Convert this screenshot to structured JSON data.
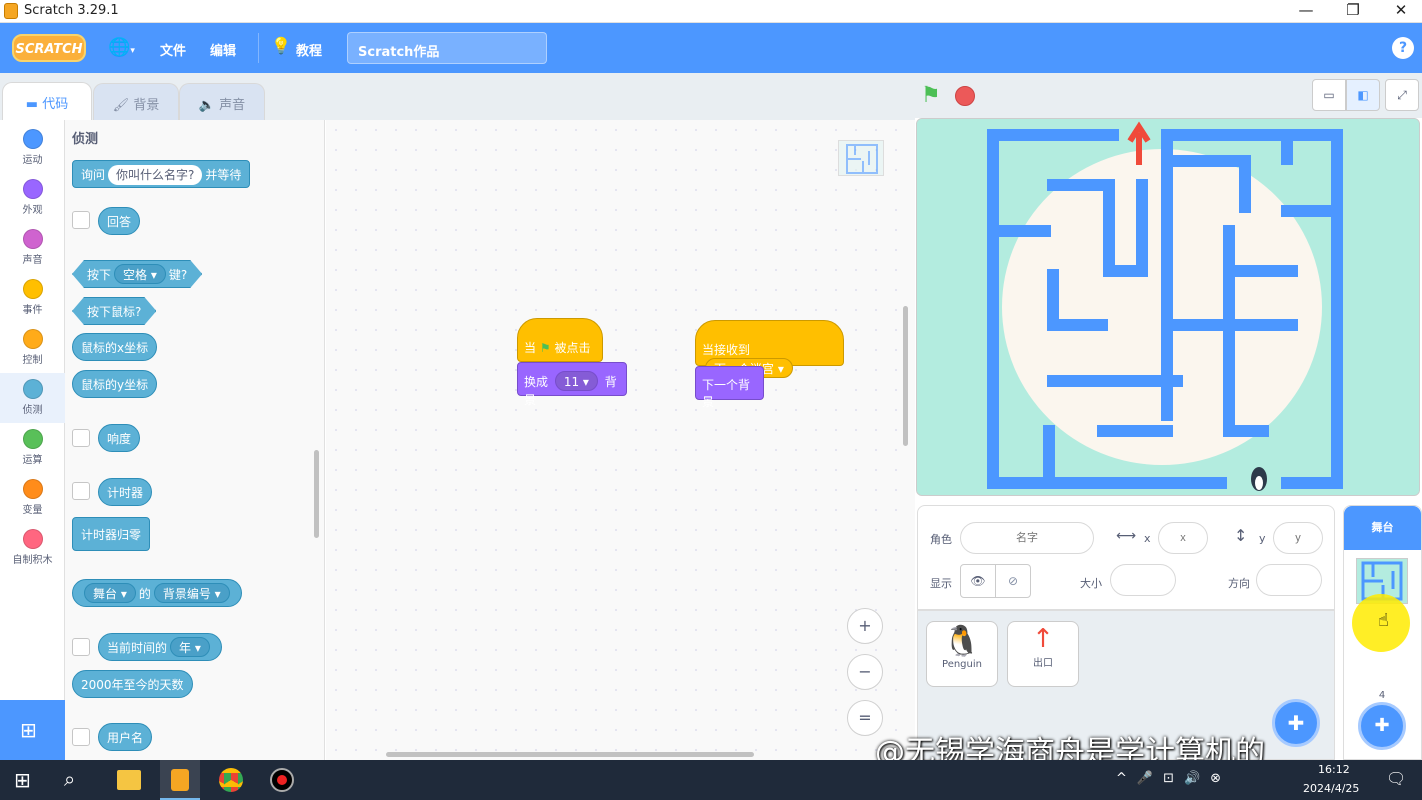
{
  "window": {
    "title": "Scratch 3.29.1",
    "min": "—",
    "restore": "❐",
    "close": "✕"
  },
  "menubar": {
    "logo": "SCRATCH",
    "file": "文件",
    "edit": "编辑",
    "tutorials": "教程",
    "project_title": "Scratch作品",
    "help": "?"
  },
  "tabs": [
    {
      "label": "代码"
    },
    {
      "label": "背景"
    },
    {
      "label": "声音"
    }
  ],
  "categories": [
    {
      "label": "运动",
      "color": "#4c97ff"
    },
    {
      "label": "外观",
      "color": "#9966ff"
    },
    {
      "label": "声音",
      "color": "#cf63cf"
    },
    {
      "label": "事件",
      "color": "#ffbf00"
    },
    {
      "label": "控制",
      "color": "#ffab19"
    },
    {
      "label": "侦测",
      "color": "#5cb1d6"
    },
    {
      "label": "运算",
      "color": "#59c059"
    },
    {
      "label": "变量",
      "color": "#ff8c1a"
    },
    {
      "label": "自制积木",
      "color": "#ff6680"
    }
  ],
  "palette": {
    "heading": "侦测",
    "ask_pre": "询问",
    "ask_input": "你叫什么名字?",
    "ask_post": "并等待",
    "answer": "回答",
    "key_pre": "按下",
    "key_drop": "空格 ▾",
    "key_post": "键?",
    "mouse_down": "按下鼠标?",
    "mouse_x": "鼠标的x坐标",
    "mouse_y": "鼠标的y坐标",
    "loudness": "响度",
    "timer": "计时器",
    "reset_timer": "计时器归零",
    "of_target": "舞台 ▾",
    "of_mid": "的",
    "of_prop": "背景编号 ▾",
    "current_pre": "当前时间的",
    "current_drop": "年 ▾",
    "days_since": "2000年至今的天数",
    "username": "用户名"
  },
  "workspace": {
    "script1": {
      "hat_pre": "当",
      "hat_post": "被点击",
      "switch_pre": "换成",
      "switch_drop": "11 ▾",
      "switch_post": "背景"
    },
    "script2": {
      "hat_pre": "当接收到",
      "hat_drop": "下一个迷宫 ▾",
      "next": "下一个背景"
    },
    "zoom_in": "+",
    "zoom_out": "−",
    "reset": "="
  },
  "sprite_info": {
    "sprite_label": "角色",
    "sprite_name_placeholder": "名字",
    "x_label": "x",
    "x_placeholder": "x",
    "y_label": "y",
    "y_placeholder": "y",
    "show_label": "显示",
    "size_label": "大小",
    "direction_label": "方向"
  },
  "sprites": [
    {
      "name": "Penguin"
    },
    {
      "name": "出口"
    }
  ],
  "stage_pane": {
    "label": "舞台",
    "backdrop_count": "4"
  },
  "watermark": "@无锡学海商舟是学计算机的",
  "taskbar": {
    "time": "16:12",
    "date": "2024/4/25"
  }
}
